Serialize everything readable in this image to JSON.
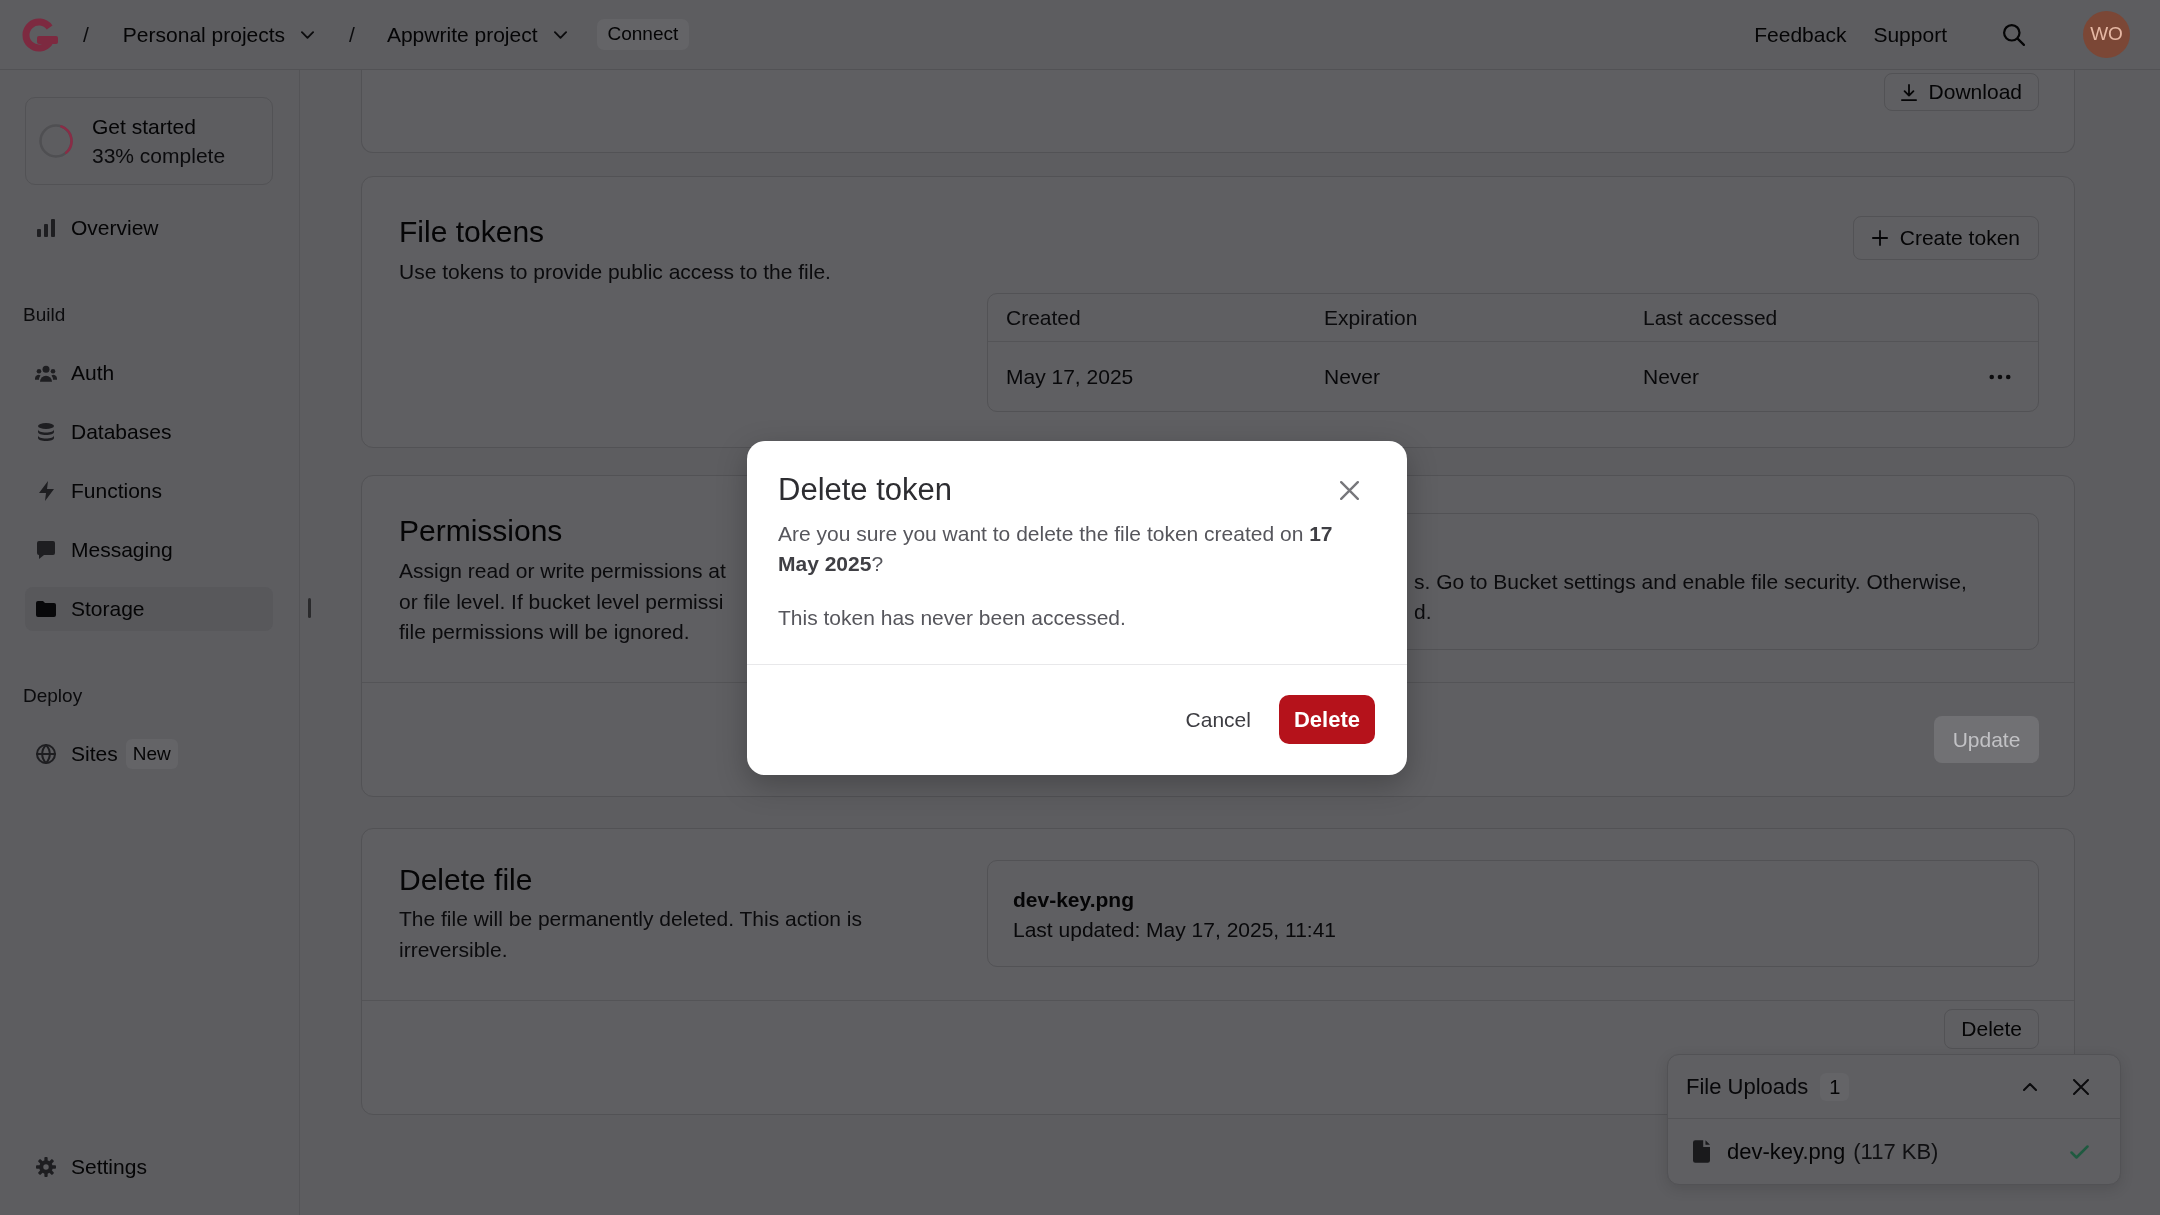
{
  "top_bar": {
    "breadcrumbs": [
      {
        "separator": "/",
        "label": "Personal projects"
      },
      {
        "separator": "/",
        "label": "Appwrite project"
      }
    ],
    "connect_button": "Connect",
    "links": [
      "Feedback",
      "Support"
    ],
    "avatar": "WO"
  },
  "sidebar": {
    "progress": {
      "title": "Get started",
      "subtitle": "33% complete",
      "level": 0.33
    },
    "sections": [
      {
        "items": [
          {
            "label": "Overview",
            "selected": false
          }
        ]
      },
      {
        "heading": "Build",
        "items": [
          {
            "label": "Auth",
            "selected": false
          },
          {
            "label": "Databases",
            "selected": false
          },
          {
            "label": "Functions",
            "selected": false
          },
          {
            "label": "Messaging",
            "selected": false
          },
          {
            "label": "Storage",
            "selected": true
          }
        ]
      },
      {
        "heading": "Deploy",
        "items": [
          {
            "label": "Sites",
            "badge": "New",
            "selected": false
          }
        ]
      }
    ],
    "footer_item": {
      "label": "Settings",
      "selected": false
    }
  },
  "file_header": {
    "download_button": "Download"
  },
  "file_tokens": {
    "title": "File tokens",
    "description": "Use tokens to provide public access to the file.",
    "create_button": "Create token",
    "table": {
      "columns": [
        "Created",
        "Expiration",
        "Last accessed"
      ],
      "rows": [
        {
          "cells": [
            "May 17, 2025",
            "Never",
            "Never"
          ]
        }
      ]
    }
  },
  "permissions": {
    "title": "Permissions",
    "description_lines": [
      "Assign read or write permissions at",
      "or file level. If bucket level permissi",
      "file permissions will be ignored."
    ],
    "notice_lines": [
      "s. Go to Bucket settings and enable file security. Otherwise,",
      "d."
    ],
    "update_button": {
      "label": "Update",
      "disabled": true
    }
  },
  "delete_file": {
    "title": "Delete file",
    "description": "The file will be permanently deleted. This action is irreversible.",
    "file": {
      "name": "dev-key.png",
      "updated": "Last updated: May 17, 2025, 11:41"
    },
    "delete_button": "Delete"
  },
  "uploads": {
    "title": "File Uploads",
    "count": "1",
    "files": [
      {
        "name": "dev-key.png",
        "size": "(117 KB)",
        "done": true
      }
    ]
  },
  "dialog": {
    "title": "Delete token",
    "message": "Are you sure you want to delete the file token created on **17 May 2025**?",
    "note": "This token has never been accessed.",
    "cancel_button": "Cancel",
    "confirm_button": "Delete"
  }
}
